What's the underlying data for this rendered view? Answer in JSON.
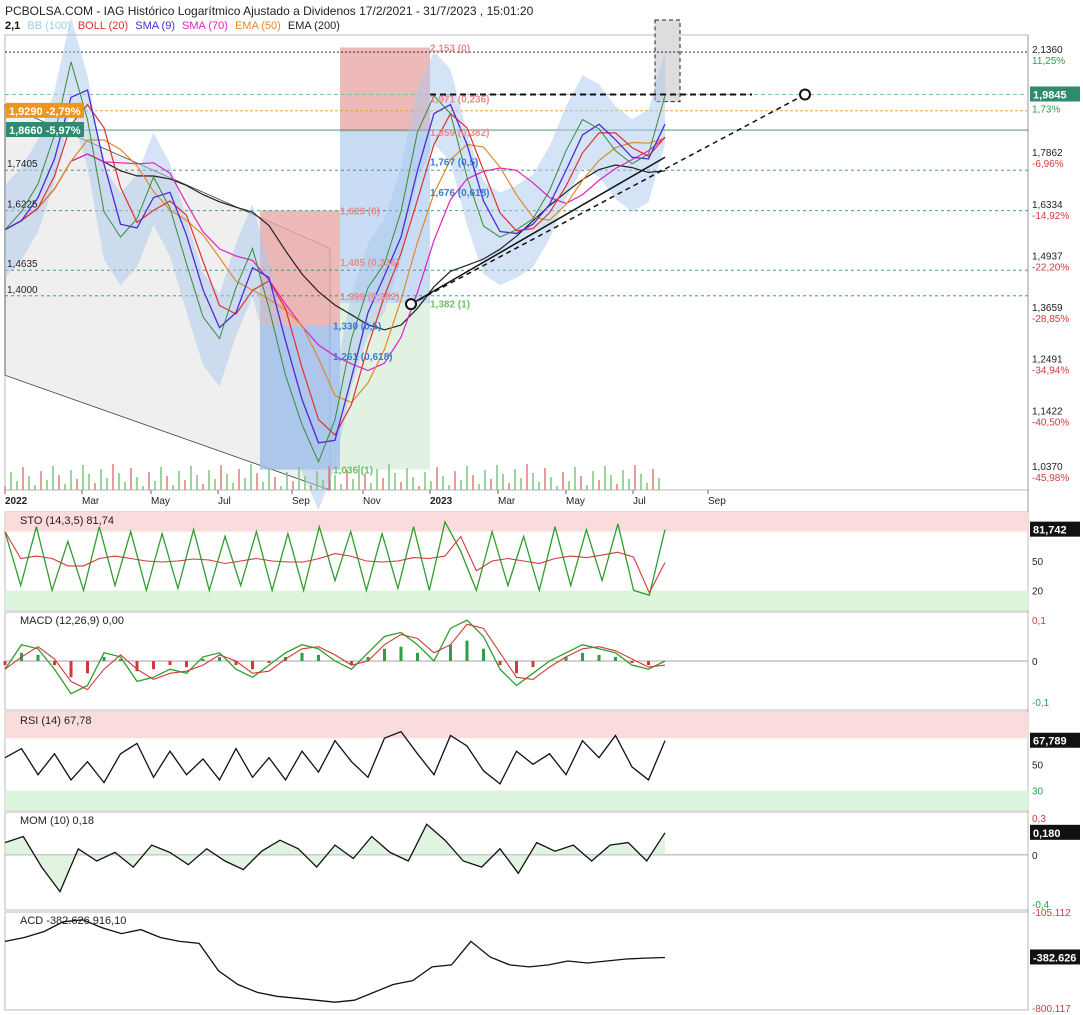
{
  "header": {
    "title": "PCBOLSA.COM - IAG Histórico Logarítmico Ajustado a Dividenos 17/2/2021 - 31/7/2023 , 15:01:20",
    "price_label": "2,1",
    "legend": [
      {
        "text": "BB (100)",
        "color": "#9ccbe8"
      },
      {
        "text": "BOLL (20)",
        "color": "#e03030"
      },
      {
        "text": "SMA (9)",
        "color": "#4b2bd8"
      },
      {
        "text": "SMA (70)",
        "color": "#e020c0"
      },
      {
        "text": "EMA (50)",
        "color": "#e08a2a"
      },
      {
        "text": "EMA (200)",
        "color": "#222222"
      }
    ]
  },
  "colors": {
    "bollinger": "#e03030",
    "sma9": "#4b2bd8",
    "sma70": "#e020c0",
    "ema50": "#e08a2a",
    "ema200": "#222222",
    "bb_fill": "#a9c8ec",
    "price": "#3a8a3a",
    "up": "#2e9e4a",
    "down": "#d03a3a",
    "overbought": "#fbdcdc",
    "oversold": "#dcf5dc"
  },
  "chart_data": [
    {
      "type": "line",
      "title": "IAG Histórico Logarítmico Ajustado a Dividenos",
      "x_tick_labels": [
        "2022",
        "Mar",
        "May",
        "Jul",
        "Sep",
        "Nov",
        "2023",
        "Mar",
        "May",
        "Jul",
        "Sep"
      ],
      "y_axis_labels": [
        {
          "value": "2,1360",
          "pct": "11,25%"
        },
        {
          "value": "1,7862",
          "pct": "-6,96%"
        },
        {
          "value": "1,6334",
          "pct": "-14,92%"
        },
        {
          "value": "1,4937",
          "pct": "-22,20%"
        },
        {
          "value": "1,3659",
          "pct": "-28,85%"
        },
        {
          "value": "1,2491",
          "pct": "-34,94%"
        },
        {
          "value": "1,1422",
          "pct": "-40,50%"
        },
        {
          "value": "1,0370",
          "pct": "-45,98%"
        }
      ],
      "last_price": {
        "value": "1,9845",
        "pct": "1,73%"
      },
      "price_tags": [
        {
          "text": "1,9290 -2,79%",
          "color": "#f0961c"
        },
        {
          "text": "1,8660 -5,97%",
          "color": "#2e8b6e"
        }
      ],
      "level_labels": [
        "1,7405",
        "1,6225",
        "1,4635",
        "1,4000"
      ],
      "fibonacci_labels": [
        {
          "text": "2,153 (0)",
          "color": "#e88a8a"
        },
        {
          "text": "1,971 (0,236)",
          "color": "#e88a8a"
        },
        {
          "text": "1,859 (0,382)",
          "color": "#e88a8a"
        },
        {
          "text": "1,767 (0,5)",
          "color": "#3a7ad0"
        },
        {
          "text": "1,676 (0,618)",
          "color": "#3a7ad0"
        },
        {
          "text": "1,623 (0)",
          "color": "#e88a8a"
        },
        {
          "text": "1,485 (0,236)",
          "color": "#e88a8a"
        },
        {
          "text": "1,399 (0,382)",
          "color": "#e88a8a"
        },
        {
          "text": "1,382 (1)",
          "color": "#6ac06a"
        },
        {
          "text": "1,330 (0,5)",
          "color": "#3a7ad0"
        },
        {
          "text": "1,261 (0,618)",
          "color": "#3a7ad0"
        },
        {
          "text": "1,036 (1)",
          "color": "#6ac06a"
        }
      ],
      "price_series": [
        1.57,
        1.62,
        1.7,
        1.85,
        2.1,
        1.9,
        1.62,
        1.55,
        1.6,
        1.72,
        1.63,
        1.48,
        1.35,
        1.3,
        1.42,
        1.52,
        1.37,
        1.22,
        1.12,
        1.05,
        1.13,
        1.3,
        1.42,
        1.48,
        1.62,
        1.86,
        1.98,
        1.92,
        1.72,
        1.58,
        1.55,
        1.57,
        1.6,
        1.68,
        1.8,
        1.9,
        1.87,
        1.8,
        1.76,
        1.79,
        1.98
      ]
    },
    {
      "type": "line",
      "title": "STO (14,3,5)",
      "value_text": "81,74",
      "last_tag": "81,742",
      "y_axis_labels": [
        "50",
        "20"
      ],
      "series": [
        {
          "values": [
            80,
            25,
            85,
            20,
            70,
            20,
            85,
            25,
            80,
            20,
            78,
            22,
            82,
            20,
            75,
            25,
            80,
            20,
            78,
            20,
            85,
            30,
            80,
            20,
            78,
            22,
            85,
            20,
            90,
            60,
            20,
            80,
            25,
            75,
            20,
            85,
            25,
            82,
            30,
            88,
            20,
            15,
            82
          ]
        }
      ]
    },
    {
      "type": "line",
      "title": "MACD (12,26,9)",
      "value_text": "0,00",
      "y_axis_labels": [
        "0,1",
        "0",
        "-0,1"
      ],
      "series": [
        {
          "values": [
            -0.02,
            0.04,
            0.03,
            -0.02,
            -0.08,
            -0.06,
            0.02,
            0.01,
            -0.05,
            -0.04,
            -0.02,
            -0.03,
            0.01,
            0.02,
            -0.02,
            -0.04,
            -0.01,
            0.02,
            0.04,
            0.03,
            0.0,
            -0.02,
            0.02,
            0.06,
            0.07,
            0.04,
            0.0,
            0.08,
            0.1,
            0.06,
            -0.02,
            -0.06,
            -0.03,
            0.0,
            0.02,
            0.04,
            0.03,
            0.02,
            -0.01,
            -0.02,
            0.0
          ]
        }
      ]
    },
    {
      "type": "line",
      "title": "RSI (14)",
      "value_text": "67,78",
      "last_tag": "67,789",
      "y_axis_labels": [
        "50",
        "30"
      ],
      "series": [
        {
          "values": [
            55,
            62,
            42,
            58,
            38,
            52,
            36,
            58,
            66,
            40,
            60,
            42,
            54,
            38,
            62,
            40,
            55,
            38,
            60,
            44,
            68,
            52,
            40,
            70,
            75,
            58,
            42,
            72,
            64,
            45,
            35,
            60,
            50,
            58,
            42,
            68,
            55,
            72,
            48,
            38,
            68
          ]
        }
      ]
    },
    {
      "type": "line",
      "title": "MOM (10)",
      "value_text": "0,18",
      "last_tag": "0,180",
      "y_axis_labels": [
        "0,3",
        "0",
        "-0,4"
      ],
      "series": [
        {
          "values": [
            0.1,
            0.15,
            -0.1,
            -0.3,
            0.05,
            -0.05,
            0.02,
            -0.1,
            0.08,
            0.02,
            -0.08,
            0.05,
            -0.05,
            -0.12,
            0.03,
            0.12,
            0.05,
            -0.1,
            0.08,
            -0.03,
            0.15,
            0.02,
            -0.05,
            0.25,
            0.12,
            -0.05,
            -0.1,
            0.05,
            -0.15,
            0.1,
            0.03,
            0.08,
            -0.05,
            0.08,
            0.1,
            -0.05,
            0.18
          ]
        }
      ]
    },
    {
      "type": "line",
      "title": "ACD",
      "value_text": "-382.626.916,10",
      "last_tag": "-382.626",
      "y_axis_labels": [
        "-105.112",
        "-800.117"
      ],
      "series": [
        {
          "values": [
            -300,
            -280,
            -250,
            -200,
            -190,
            -230,
            -260,
            -240,
            -280,
            -300,
            -310,
            -450,
            -520,
            -560,
            -580,
            -590,
            -600,
            -610,
            -600,
            -560,
            -520,
            -500,
            -430,
            -420,
            -300,
            -380,
            -420,
            -430,
            -420,
            -400,
            -410,
            -400,
            -390,
            -385,
            -382
          ]
        }
      ]
    }
  ]
}
